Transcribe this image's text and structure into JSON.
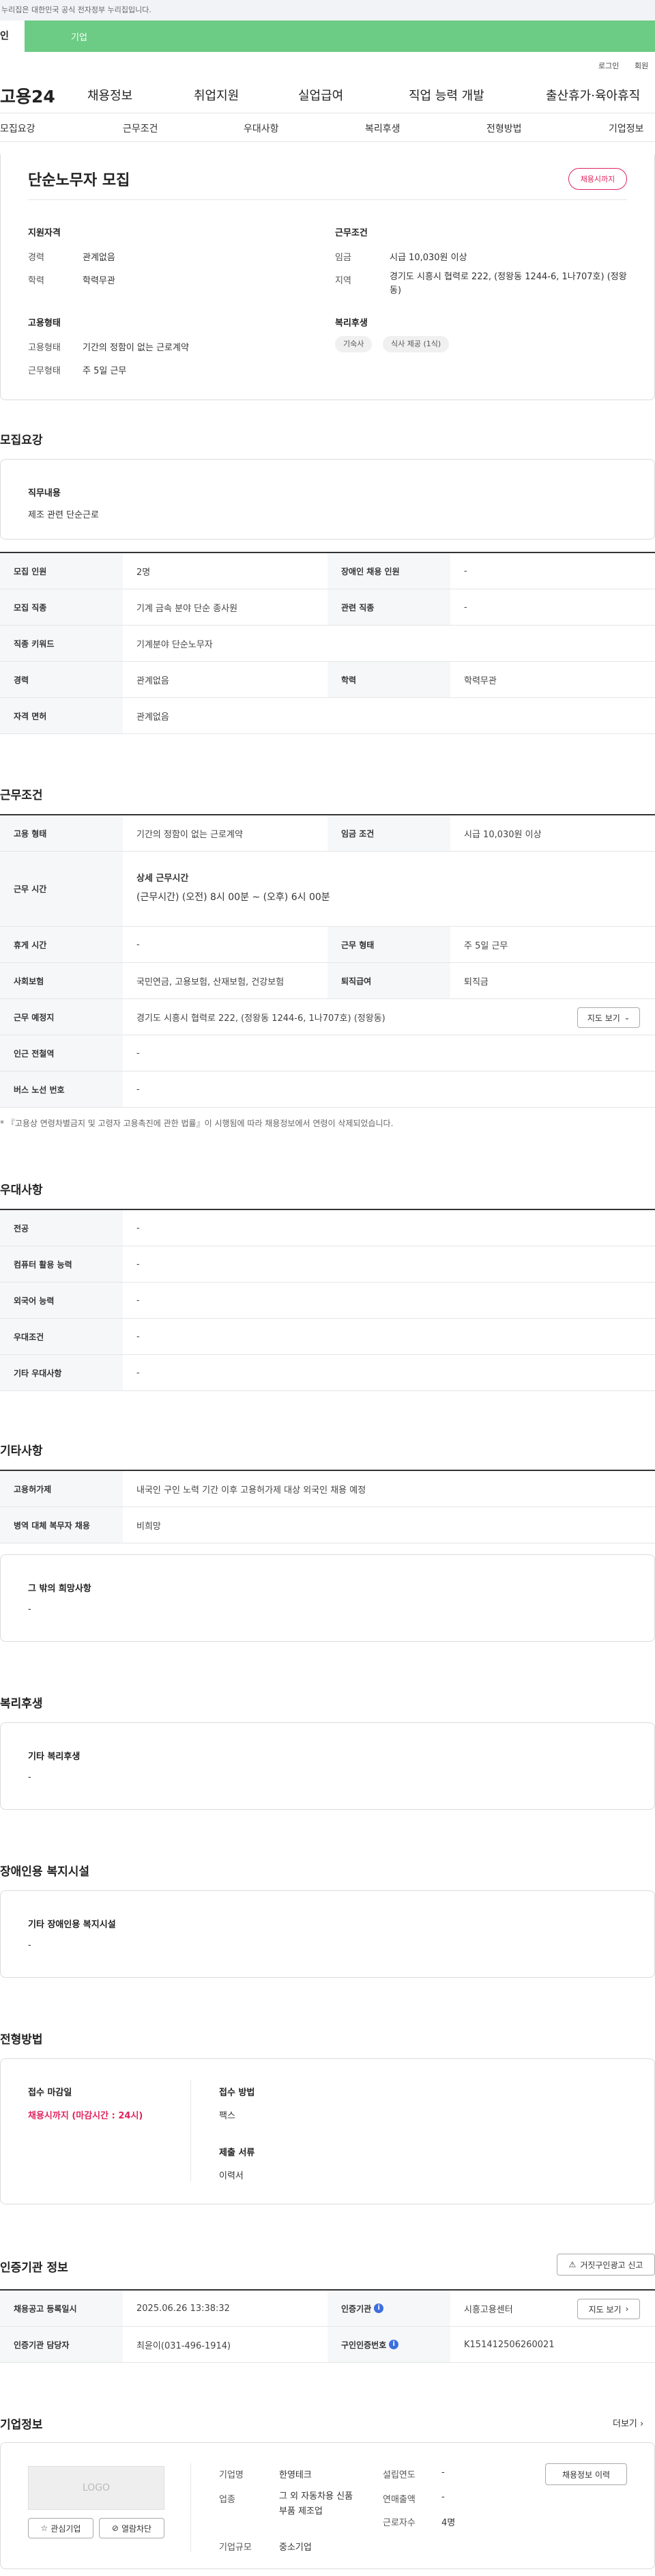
{
  "gov_banner": "이 누리집은 대한민국 공식 전자정부 누리집입니다.",
  "gov_banner_visible": "누리집은 대한민국 공식 전자정부 누리집입니다.",
  "tabs": {
    "individual": "인",
    "company": "기업"
  },
  "util": {
    "login": "로그인",
    "join": "회원"
  },
  "logo": "고용24",
  "gnb": [
    "채용정보",
    "취업지원",
    "실업급여",
    "직업 능력 개발",
    "출산휴가·육아휴직"
  ],
  "anchor": [
    "모집요강",
    "근무조건",
    "우대사항",
    "복리후생",
    "전형방법",
    "기업정보"
  ],
  "top": {
    "title": "단순노무자 모집",
    "deadline_badge": "채용시까지",
    "qual_title": "지원자격",
    "qual": [
      {
        "k": "경력",
        "v": "관계없음"
      },
      {
        "k": "학력",
        "v": "학력무관"
      }
    ],
    "cond_title": "근무조건",
    "cond": [
      {
        "k": "임금",
        "v": "시급 10,030원 이상"
      },
      {
        "k": "지역",
        "v": "경기도 시흥시 협력로 222, (정왕동 1244-6, 1나707호) (정왕동)"
      }
    ],
    "emp_title": "고용형태",
    "emp": [
      {
        "k": "고용형태",
        "v": "기간의 정함이 없는 근로계약"
      },
      {
        "k": "근무형태",
        "v": "주 5일 근무"
      }
    ],
    "welfare_title": "복리후생",
    "welfare_tags": [
      "기숙사",
      "식사 제공 (1식)"
    ]
  },
  "recruit": {
    "title": "모집요강",
    "duty_label": "직무내용",
    "duty": "제조 관련 단순근로",
    "rows": [
      {
        "th": "모집 인원",
        "td": "2명",
        "th2": "장애인 채용 인원",
        "td2": "-"
      },
      {
        "th": "모집 직종",
        "td": "기계 금속 분야 단순 종사원",
        "th2": "관련 직종",
        "td2": "-"
      },
      {
        "th": "직종 키워드",
        "td": "기계분야 단순노무자"
      },
      {
        "th": "경력",
        "td": "관계없음",
        "th2": "학력",
        "td2": "학력무관"
      },
      {
        "th": "자격 면허",
        "td": "관계없음"
      }
    ]
  },
  "work": {
    "title": "근무조건",
    "r1": {
      "th": "고용 형태",
      "td": "기간의 정함이 없는 근로계약",
      "th2": "임금 조건",
      "td2": "시급 10,030원 이상"
    },
    "r2": {
      "th": "근무 시간",
      "sub": "상세 근무시간",
      "td": "(근무시간) (오전) 8시 00분 ~ (오후) 6시 00분"
    },
    "r3": {
      "th": "휴게 시간",
      "td": "-",
      "th2": "근무 형태",
      "td2": "주 5일 근무"
    },
    "r4": {
      "th": "사회보험",
      "td": "국민연금, 고용보험, 산재보험, 건강보험",
      "th2": "퇴직급여",
      "td2": "퇴직금"
    },
    "r5": {
      "th": "근무 예정지",
      "td": "경기도 시흥시 협력로 222, (정왕동 1244-6, 1나707호) (정왕동)",
      "btn": "지도 보기"
    },
    "r6": {
      "th": "인근 전철역",
      "td": "-"
    },
    "r7": {
      "th": "버스 노선 번호",
      "td": "-"
    },
    "note": "* 『고용상 연령차별금지 및 고령자 고용촉진에 관한 법률』이 시행됨에 따라 채용정보에서 연령이 삭제되었습니다."
  },
  "pref": {
    "title": "우대사항",
    "rows": [
      {
        "th": "전공",
        "td": "-"
      },
      {
        "th": "컴퓨터 활용 능력",
        "td": "-"
      },
      {
        "th": "외국어 능력",
        "td": "-"
      },
      {
        "th": "우대조건",
        "td": "-"
      },
      {
        "th": "기타 우대사항",
        "td": "-"
      }
    ]
  },
  "etc": {
    "title": "기타사항",
    "rows": [
      {
        "th": "고용허가제",
        "td": "내국인 구인 노력 기간 이후 고용허가제 대상 외국인 채용 예정"
      },
      {
        "th": "병역 대체 복무자 채용",
        "td": "비희망"
      }
    ],
    "other_label": "그 밖의 희망사항",
    "other": "-"
  },
  "welfare": {
    "title": "복리후생",
    "label": "기타 복리후생",
    "value": "-"
  },
  "disabled": {
    "title": "장애인용 복지시설",
    "label": "기타 장애인용 복지시설",
    "value": "-"
  },
  "selection": {
    "title": "전형방법",
    "deadline_label": "접수 마감일",
    "deadline": "채용시까지 (마감시간 : 24시)",
    "method_label": "접수 방법",
    "method": "팩스",
    "docs_label": "제출 서류",
    "docs": "이력서"
  },
  "cert": {
    "title": "인증기관 정보",
    "report_btn": "거짓구인광고 신고",
    "r1": {
      "th": "채용공고 등록일시",
      "td": "2025.06.26 13:38:32",
      "th2": "인증기관",
      "td2": "시흥고용센터",
      "btn": "지도 보기"
    },
    "r2": {
      "th": "인증기관 담당자",
      "td": "최윤이(031-496-1914)",
      "th2": "구인인증번호",
      "td2": "K151412506260021"
    }
  },
  "company": {
    "title": "기업정보",
    "more": "더보기",
    "logo_text": "LOGO",
    "fav_btn": "관심기업",
    "block_btn": "열람차단",
    "name_k": "기업명",
    "name_v": "한영테크",
    "biz_k": "업종",
    "biz_v": "그 외 자동차용 신품 부품 제조업",
    "size_k": "기업규모",
    "size_v": "중소기업",
    "est_k": "설립연도",
    "est_v": "-",
    "rev_k": "연매출액",
    "rev_v": "-",
    "emp_k": "근로자수",
    "emp_v": "4명",
    "history_btn": "채용정보 이력"
  }
}
